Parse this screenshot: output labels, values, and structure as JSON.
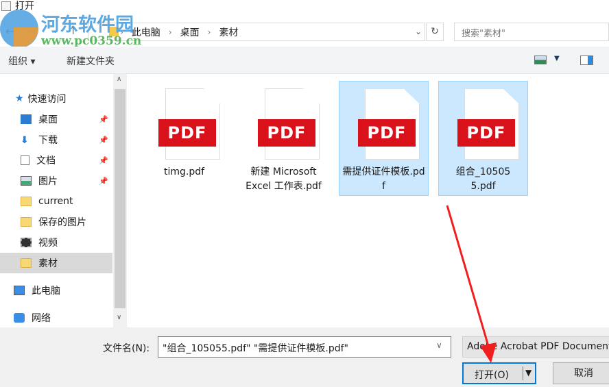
{
  "window": {
    "title": "打开"
  },
  "watermark": {
    "name": "河东软件园",
    "url": "www.pc0359.cn"
  },
  "address": {
    "crumbs": [
      "此电脑",
      "桌面",
      "素材"
    ],
    "search_placeholder": "搜索\"素材\""
  },
  "toolbar": {
    "organize": "组织 ▾",
    "new_folder": "新建文件夹"
  },
  "nav": [
    {
      "label": "快速访问",
      "pin": false
    },
    {
      "label": "桌面",
      "pin": true
    },
    {
      "label": "下载",
      "pin": true
    },
    {
      "label": "文档",
      "pin": true
    },
    {
      "label": "图片",
      "pin": true
    },
    {
      "label": "current",
      "pin": false
    },
    {
      "label": "保存的图片",
      "pin": false
    },
    {
      "label": "视频",
      "pin": false
    },
    {
      "label": "素材",
      "pin": false,
      "selected": true
    },
    {
      "label": "此电脑",
      "pin": false
    },
    {
      "label": "网络",
      "pin": false
    }
  ],
  "files": [
    {
      "badge": "PDF",
      "name": "timg.pdf",
      "selected": false
    },
    {
      "badge": "PDF",
      "name": "新建 Microsoft Excel 工作表.pdf",
      "selected": false
    },
    {
      "badge": "PDF",
      "name": "需提供证件模板.pdf",
      "selected": true
    },
    {
      "badge": "PDF",
      "name": "组合_105055.pdf",
      "selected": true
    }
  ],
  "bottom": {
    "filename_label": "文件名(N):",
    "filename_value": "\"组合_105055.pdf\" \"需提供证件模板.pdf\"",
    "filetype": "Adobe Acrobat PDF Document",
    "open": "打开(O)",
    "cancel": "取消"
  },
  "colors": {
    "accent": "#0078d7",
    "selection": "#cce8ff",
    "pdf": "#d9111b",
    "annotation_arrow": "#f01e1e"
  }
}
